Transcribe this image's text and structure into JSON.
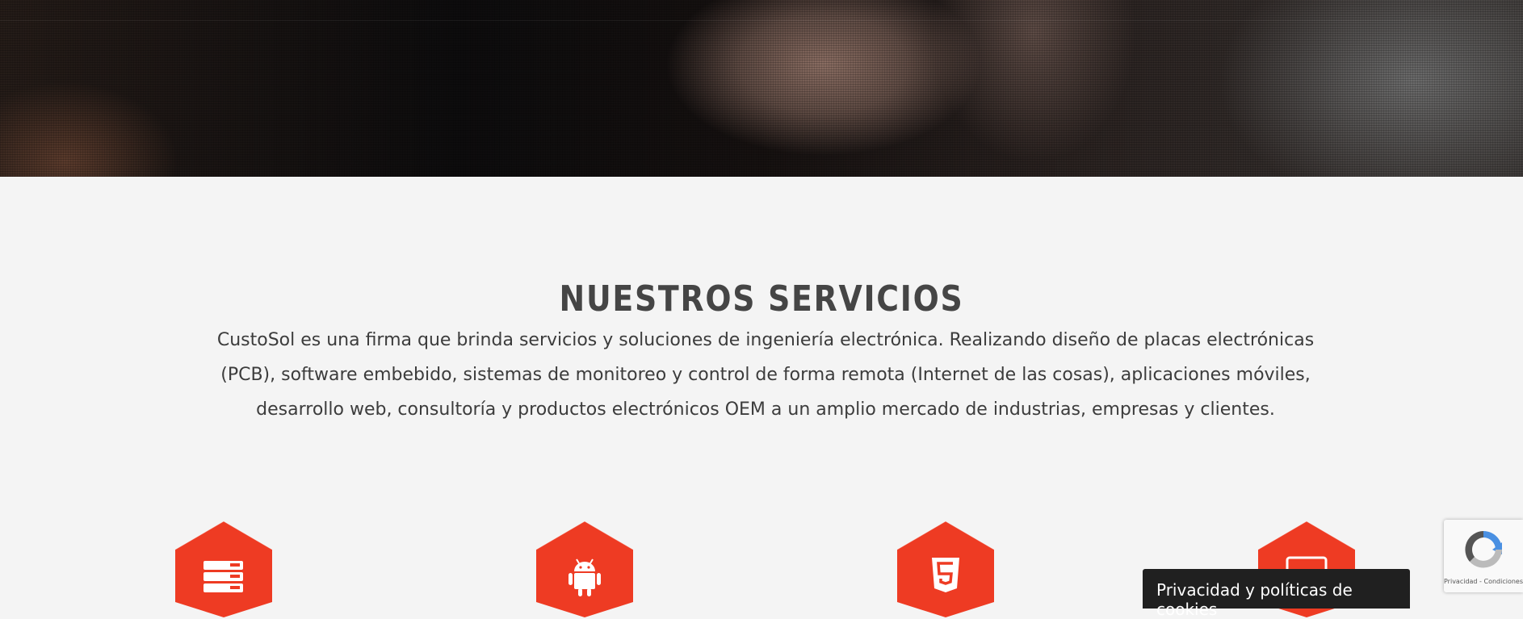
{
  "section": {
    "title": "NUESTROS SERVICIOS",
    "intro_lines": [
      "CustoSol es una firma que brinda servicios y soluciones de ingeniería electrónica. Realizando diseño de placas electrónicas",
      "(PCB), software embebido, sistemas de monitoreo y control de forma remota (Internet de las cosas), aplicaciones móviles,",
      "desarrollo web, consultoría y productos electrónicos OEM a un amplio mercado de industrias, empresas y clientes."
    ]
  },
  "services": [
    {
      "icon": "server-icon"
    },
    {
      "icon": "android-icon"
    },
    {
      "icon": "html5-icon"
    },
    {
      "icon": "monitor-icon"
    }
  ],
  "cookie_bar": {
    "label": "Privacidad y políticas de cookies"
  },
  "recaptcha": {
    "label": "Privacidad - Condiciones"
  },
  "colors": {
    "accent": "#ee3b23",
    "background": "#f4f4f4",
    "title": "#454545",
    "cookie_bg": "#202020"
  }
}
